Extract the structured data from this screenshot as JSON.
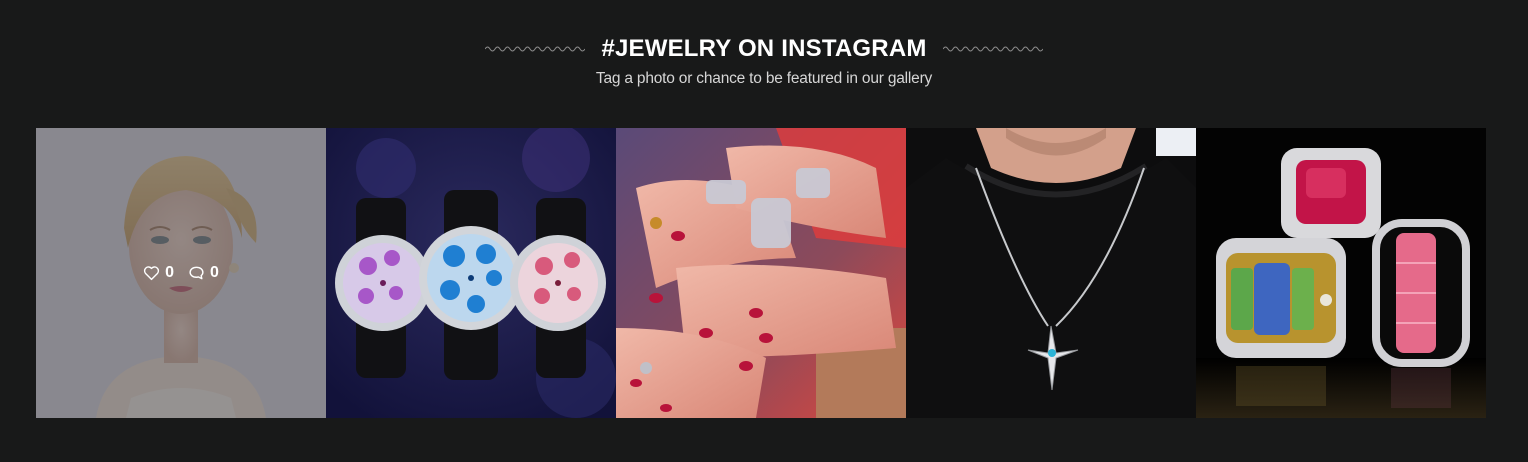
{
  "section": {
    "title": "#JEWELRY ON INSTAGRAM",
    "subtitle": "Tag a photo or chance to be featured in our gallery"
  },
  "gallery": {
    "items": [
      {
        "subject": "woman-with-earrings",
        "likes": "0",
        "comments": "0",
        "hovered": true
      },
      {
        "subject": "three-floral-watches"
      },
      {
        "subject": "hands-with-bracelets-and-rings"
      },
      {
        "subject": "man-wearing-cross-pendant"
      },
      {
        "subject": "gemstone-rings"
      }
    ]
  },
  "colors": {
    "background": "#181919",
    "title": "#ffffff",
    "subtitle": "#d6d6d6",
    "overlay": "rgba(70,70,75,0.55)"
  },
  "icons": {
    "title_decoration": "wavy-line-icon",
    "likes": "heart-icon",
    "comments": "comment-bubble-icon"
  }
}
